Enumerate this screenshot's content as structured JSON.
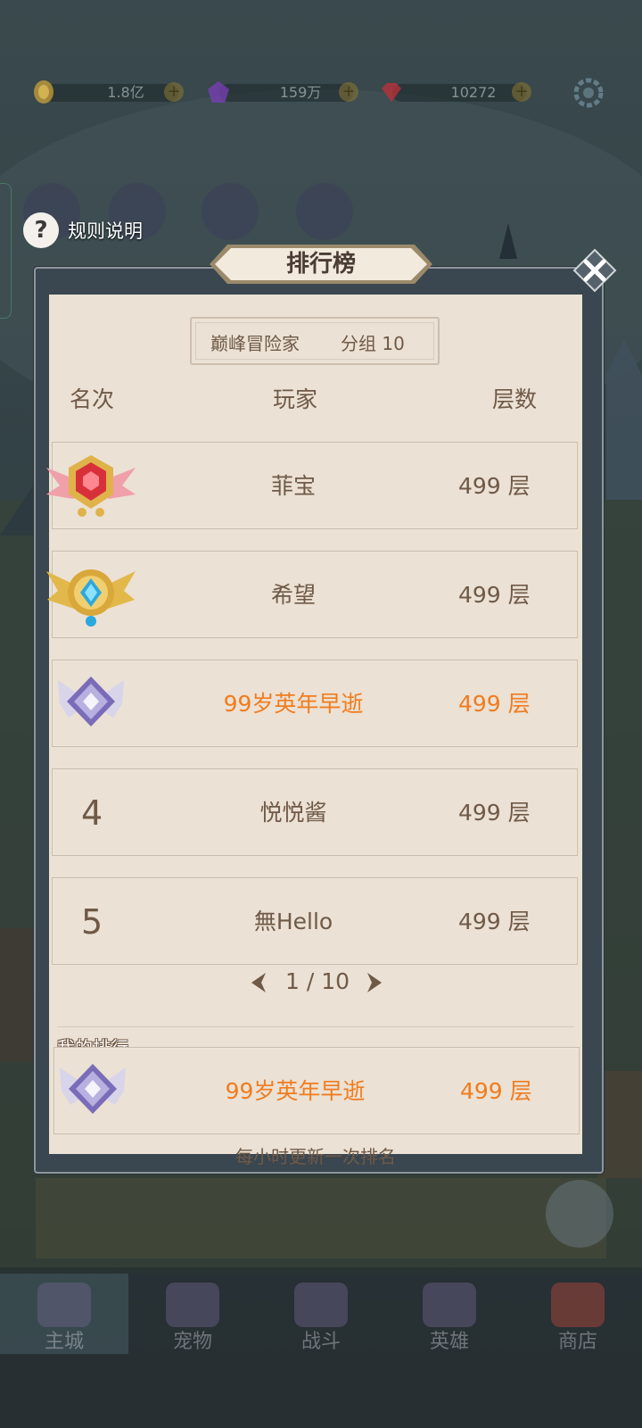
{
  "currencies": [
    {
      "icon": "gold-coin-icon",
      "value": "1.8亿"
    },
    {
      "icon": "purple-gem-icon",
      "value": "159万"
    },
    {
      "icon": "red-diamond-icon",
      "value": "10272"
    }
  ],
  "rule": {
    "label": "规则说明"
  },
  "panel": {
    "title": "排行榜",
    "group_name": "巅峰冒险家",
    "group_num": "分组 10",
    "headers": {
      "rank": "名次",
      "player": "玩家",
      "score": "层数"
    },
    "rows": [
      {
        "rank": "1",
        "name": "菲宝",
        "score": "499 层",
        "badge": "red-gem-winged-badge"
      },
      {
        "rank": "2",
        "name": "希望",
        "score": "499 层",
        "badge": "blue-gem-gold-winged-badge"
      },
      {
        "rank": "3",
        "name": "99岁英年早逝",
        "score": "499 层",
        "badge": "purple-silver-winged-badge"
      },
      {
        "rank": "4",
        "name": "悦悦酱",
        "score": "499 层"
      },
      {
        "rank": "5",
        "name": "無Hello",
        "score": "499 层"
      }
    ],
    "pager": "1 / 10",
    "my_rank_label": "我的排行",
    "my_rank": {
      "name": "99岁英年早逝",
      "score": "499 层",
      "badge": "purple-silver-winged-badge"
    },
    "footer": "每小时更新一次排名"
  },
  "nav": [
    "主城",
    "宠物",
    "战斗",
    "英雄",
    "商店"
  ],
  "colors": {
    "highlight": "#f07c1e",
    "text": "#6f5a47",
    "paper": "#ebe1d4",
    "frame": "#3a4650"
  }
}
